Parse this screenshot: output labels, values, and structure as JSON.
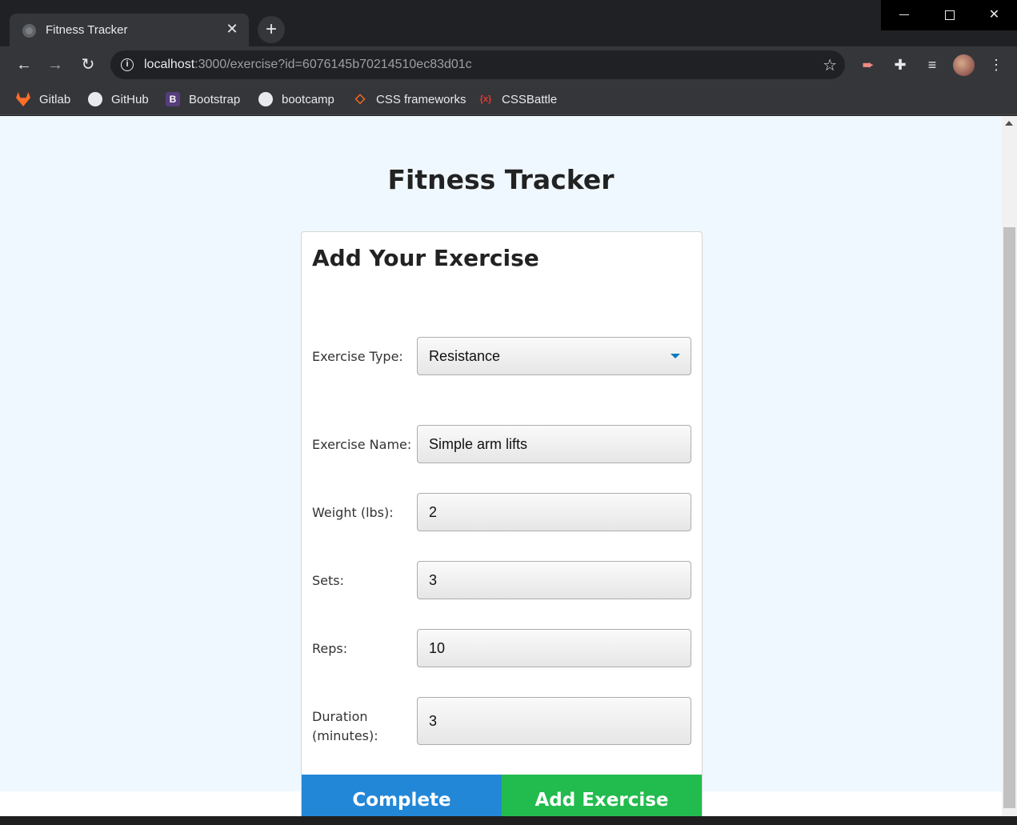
{
  "browser": {
    "tab_title": "Fitness Tracker",
    "url_host": "localhost",
    "url_rest": ":3000/exercise?id=6076145b70214510ec83d01c",
    "bookmarks": [
      {
        "label": "Gitlab",
        "icon": "gitlab-icon"
      },
      {
        "label": "GitHub",
        "icon": "github-icon"
      },
      {
        "label": "Bootstrap",
        "icon": "bootstrap-icon"
      },
      {
        "label": "bootcamp",
        "icon": "globe-icon"
      },
      {
        "label": "CSS frameworks",
        "icon": "css-frameworks-icon"
      },
      {
        "label": "CSSBattle",
        "icon": "cssbattle-icon"
      }
    ]
  },
  "page": {
    "title": "Fitness Tracker",
    "form": {
      "heading": "Add Your Exercise",
      "exercise_type": {
        "label": "Exercise Type:",
        "value": "Resistance"
      },
      "exercise_name": {
        "label": "Exercise Name:",
        "value": "Simple arm lifts"
      },
      "weight": {
        "label": "Weight (lbs):",
        "value": "2"
      },
      "sets": {
        "label": "Sets:",
        "value": "3"
      },
      "reps": {
        "label": "Reps:",
        "value": "10"
      },
      "duration": {
        "label_line1": "Duration",
        "label_line2": "(minutes):",
        "value": "3"
      }
    },
    "buttons": {
      "complete": "Complete",
      "add": "Add Exercise"
    }
  },
  "colors": {
    "page_bg": "#f0f8ff",
    "complete_button": "#2387d8",
    "add_button": "#22bb4e",
    "select_caret": "#0c7bc0"
  }
}
